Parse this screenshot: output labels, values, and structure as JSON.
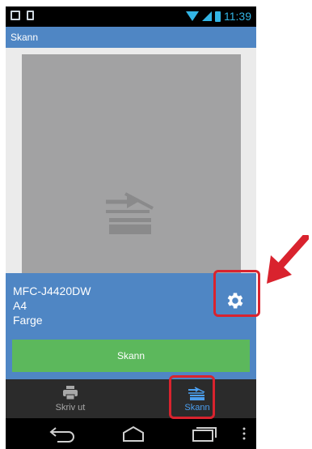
{
  "status_bar": {
    "time": "11:39"
  },
  "title_bar": {
    "title": "Skann"
  },
  "device": {
    "name": "MFC-J4420DW",
    "paper_size": "A4",
    "color_mode": "Farge"
  },
  "scan_button": {
    "label": "Skann"
  },
  "bottom_nav": {
    "items": [
      {
        "label": "Skriv ut",
        "icon": "printer-icon",
        "active": false
      },
      {
        "label": "Skann",
        "icon": "scanner-icon",
        "active": true
      }
    ]
  },
  "colors": {
    "accent": "#4f86c4",
    "scan_button": "#5cb85c",
    "highlight": "#d9232e",
    "active_tab": "#4b9ff0",
    "status_icons": "#33b5e5"
  }
}
